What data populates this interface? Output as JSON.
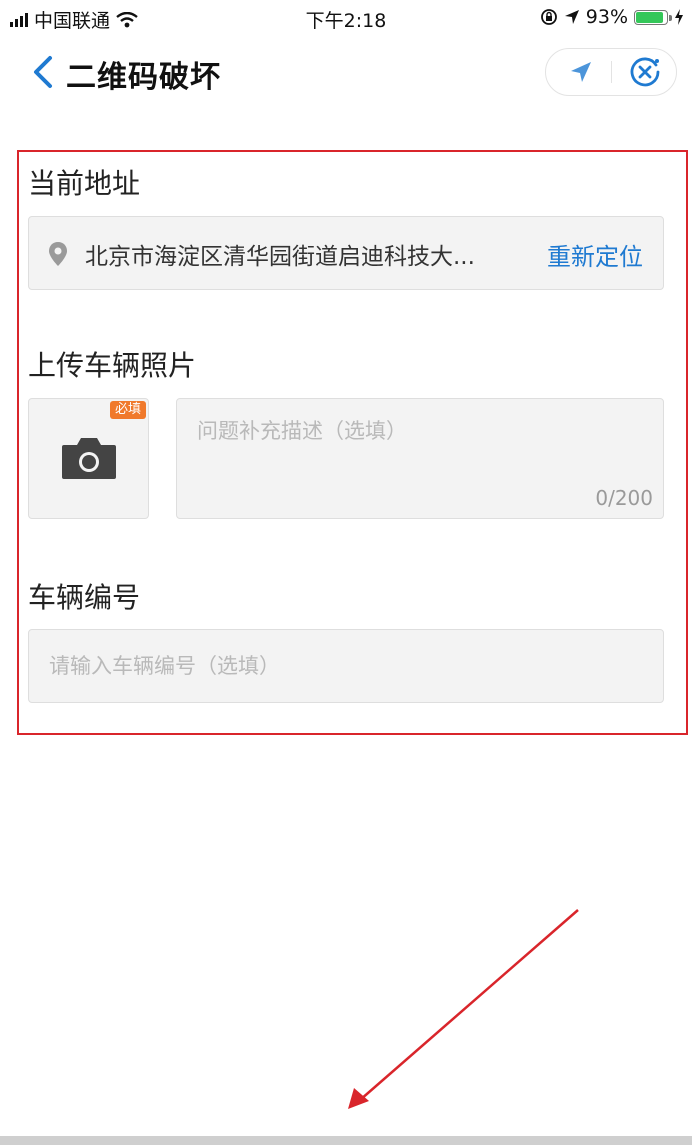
{
  "status_bar": {
    "carrier": "中国联通",
    "time": "下午2:18",
    "battery": "93%",
    "battery_level": 0.93,
    "icons": [
      "signal-icon",
      "wifi-icon",
      "orientation-lock-icon",
      "location-arrow-icon",
      "battery-icon",
      "charging-icon"
    ]
  },
  "nav": {
    "title": "二维码破坏",
    "icons": [
      "back-chevron-icon",
      "location-arrow-icon",
      "close-circle-icon"
    ]
  },
  "form": {
    "address_label": "当前地址",
    "address_value": "北京市海淀区清华园街道启迪科技大...",
    "relocate_label": "重新定位",
    "photo_label": "上传车辆照片",
    "required_badge": "必填",
    "desc_placeholder": "问题补充描述（选填）",
    "desc_counter": "0/200",
    "vehicle_label": "车辆编号",
    "vehicle_placeholder": "请输入车辆编号（选填）"
  },
  "colors": {
    "accent": "#1f7ad1",
    "annotation_red": "#d9252b",
    "badge_orange": "#f0792b",
    "battery_green": "#34c759"
  }
}
